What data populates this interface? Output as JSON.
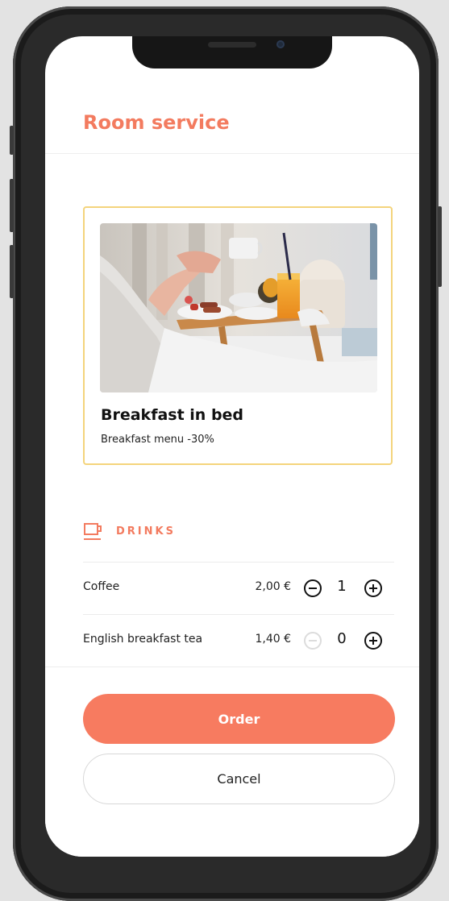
{
  "header": {
    "title": "Room service"
  },
  "promo": {
    "title": "Breakfast in bed",
    "subtitle": "Breakfast menu -30%",
    "image_icon": "breakfast-tray-photo"
  },
  "drinks": {
    "section_label": "DRINKS",
    "section_icon": "cup-icon",
    "items": [
      {
        "name": "Coffee",
        "price": "2,00 €",
        "quantity": "1",
        "minus_enabled": true
      },
      {
        "name": "English breakfast tea",
        "price": "1,40 €",
        "quantity": "0",
        "minus_enabled": false
      }
    ]
  },
  "actions": {
    "order_label": "Order",
    "cancel_label": "Cancel"
  },
  "colors": {
    "accent": "#f37b5f",
    "order_button": "#f77b60",
    "promo_border": "#f4d47c",
    "background": "#e3e3e3"
  }
}
